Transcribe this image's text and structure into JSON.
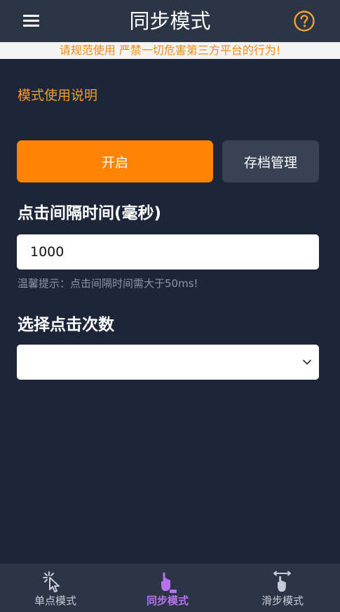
{
  "header": {
    "title": "同步模式",
    "menu_icon": "hamburger-menu-icon",
    "help_icon": "question-circle-icon"
  },
  "warning_banner": {
    "text": "请规范使用 严禁一切危害第三方平台的行为!"
  },
  "instructions_link": "模式使用说明",
  "actions": {
    "start_label": "开启",
    "archive_label": "存档管理"
  },
  "interval": {
    "label": "点击间隔时间(毫秒)",
    "value": "1000",
    "hint": "温馨提示：点击间隔时间需大于50ms!"
  },
  "click_count": {
    "label": "选择点击次数",
    "selected": ""
  },
  "bottom_nav": {
    "items": [
      {
        "label": "单点模式",
        "icon": "tap-sparkle-icon",
        "active": false
      },
      {
        "label": "同步模式",
        "icon": "finger-tap-icon",
        "active": true
      },
      {
        "label": "滑步模式",
        "icon": "swipe-hand-icon",
        "active": false
      }
    ]
  },
  "colors": {
    "background": "#1c2638",
    "header": "#2b3546",
    "accent_orange": "#ff8404",
    "warning_text": "#f08a17",
    "active_nav": "#b872f0",
    "inactive_nav": "#c7ccd6"
  }
}
